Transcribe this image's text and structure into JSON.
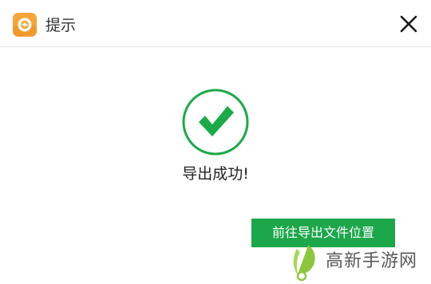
{
  "window": {
    "title": "提示",
    "logo_icon": "app-logo-icon",
    "close_icon": "close-icon"
  },
  "content": {
    "status_icon": "check-circle-icon",
    "message": "导出成功!"
  },
  "actions": {
    "open_location_label": "前往导出文件位置"
  },
  "watermark": {
    "text": "高新手游网",
    "icon": "leaf-logo-icon"
  },
  "colors": {
    "accent_green": "#1aaa48",
    "button_green": "#1ba74a",
    "logo_orange": "#f5a53a",
    "watermark_green": "#8cc63f"
  }
}
